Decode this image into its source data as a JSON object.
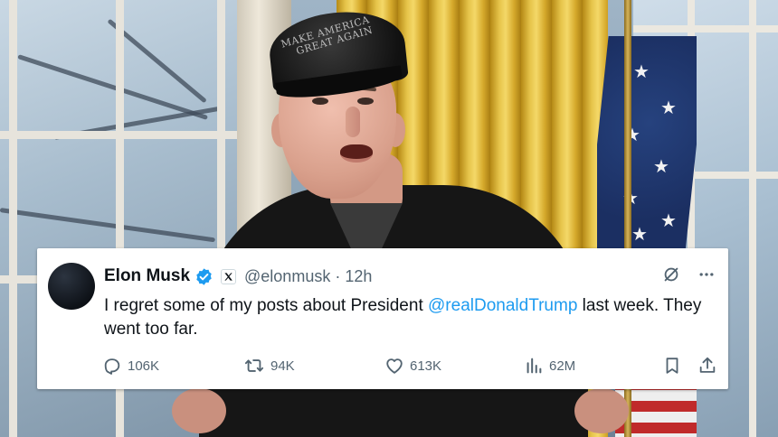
{
  "background": {
    "cap_text": [
      "MAKE AMERICA",
      "GREAT AGAIN"
    ]
  },
  "tweet": {
    "author_name": "Elon Musk",
    "handle": "@elonmusk",
    "separator": "·",
    "time": "12h",
    "text_before": "I regret some of my posts about President ",
    "mention": "@realDonaldTrump",
    "text_after": " last week. They went too far.",
    "replies": "106K",
    "reposts": "94K",
    "likes": "613K",
    "views": "62M",
    "icons": {
      "verified": "verified-badge-icon",
      "x_logo": "x-logo-icon",
      "grok": "grok-icon",
      "more": "more-icon",
      "reply": "reply-icon",
      "repost": "repost-icon",
      "like": "like-icon",
      "views": "views-icon",
      "bookmark": "bookmark-icon",
      "share": "share-icon"
    },
    "colors": {
      "verified_blue": "#1d9bf0",
      "mention_blue": "#1d9bf0",
      "muted_gray": "#536471",
      "text": "#0f1419"
    }
  }
}
